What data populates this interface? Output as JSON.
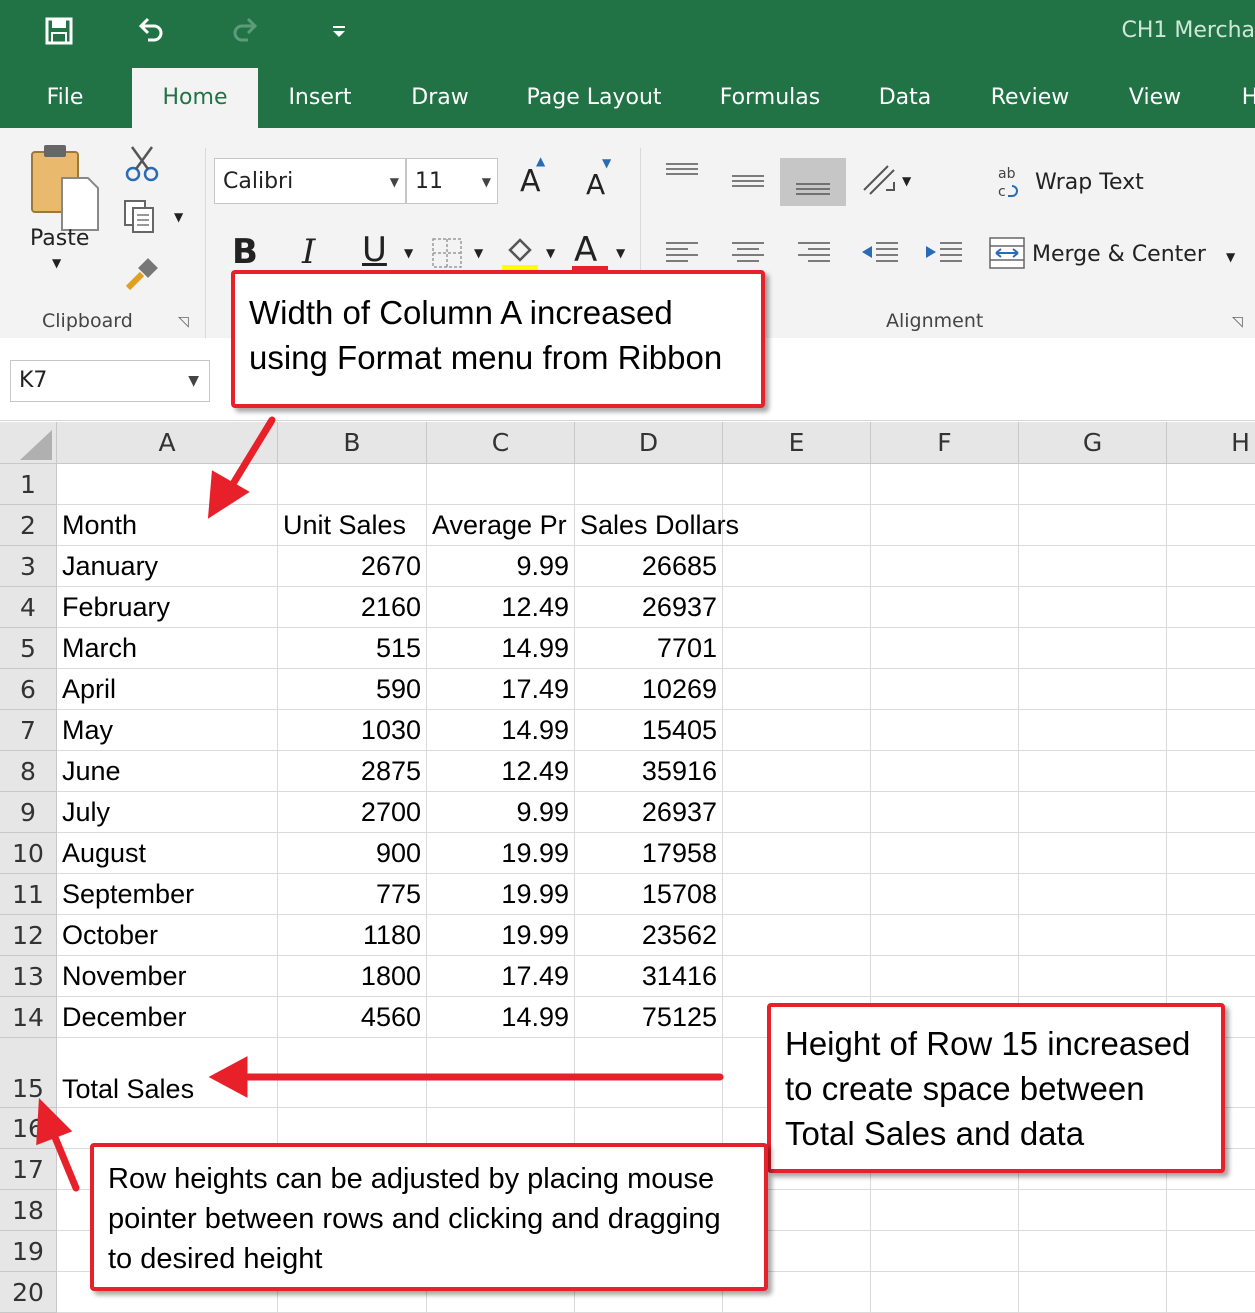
{
  "window": {
    "title": "CH1 Mercha"
  },
  "tabs": [
    "File",
    "Home",
    "Insert",
    "Draw",
    "Page Layout",
    "Formulas",
    "Data",
    "Review",
    "View",
    "H"
  ],
  "active_tab": "Home",
  "ribbon": {
    "clipboard": {
      "paste_label": "Paste",
      "group_label": "Clipboard"
    },
    "font": {
      "name": "Calibri",
      "size": "11",
      "bold": "B",
      "italic": "I",
      "underline": "U",
      "grow": "A",
      "shrink": "A",
      "font_color": "A"
    },
    "alignment": {
      "wrap_text": "Wrap Text",
      "merge_center": "Merge & Center",
      "group_label": "Alignment"
    }
  },
  "name_box": "K7",
  "columns": [
    "A",
    "B",
    "C",
    "D",
    "E",
    "F",
    "G",
    "H"
  ],
  "rows": [
    {
      "n": "1",
      "cells": [
        "",
        "",
        "",
        ""
      ]
    },
    {
      "n": "2",
      "cells": [
        "Month",
        "Unit Sales",
        "Average Pr",
        "Sales Dollars"
      ]
    },
    {
      "n": "3",
      "cells": [
        "January",
        "2670",
        "9.99",
        "26685"
      ]
    },
    {
      "n": "4",
      "cells": [
        "February",
        "2160",
        "12.49",
        "26937"
      ]
    },
    {
      "n": "5",
      "cells": [
        "March",
        "515",
        "14.99",
        "7701"
      ]
    },
    {
      "n": "6",
      "cells": [
        "April",
        "590",
        "17.49",
        "10269"
      ]
    },
    {
      "n": "7",
      "cells": [
        "May",
        "1030",
        "14.99",
        "15405"
      ]
    },
    {
      "n": "8",
      "cells": [
        "June",
        "2875",
        "12.49",
        "35916"
      ]
    },
    {
      "n": "9",
      "cells": [
        "July",
        "2700",
        "9.99",
        "26937"
      ]
    },
    {
      "n": "10",
      "cells": [
        "August",
        "900",
        "19.99",
        "17958"
      ]
    },
    {
      "n": "11",
      "cells": [
        "September",
        "775",
        "19.99",
        "15708"
      ]
    },
    {
      "n": "12",
      "cells": [
        "October",
        "1180",
        "19.99",
        "23562"
      ]
    },
    {
      "n": "13",
      "cells": [
        "November",
        "1800",
        "17.49",
        "31416"
      ]
    },
    {
      "n": "14",
      "cells": [
        "December",
        "4560",
        "14.99",
        "75125"
      ]
    },
    {
      "n": "15",
      "cells": [
        "Total Sales",
        "",
        "",
        ""
      ]
    },
    {
      "n": "16",
      "cells": [
        "",
        "",
        "",
        ""
      ]
    },
    {
      "n": "17",
      "cells": [
        "",
        "",
        "",
        ""
      ]
    },
    {
      "n": "18",
      "cells": [
        "",
        "",
        "",
        ""
      ]
    },
    {
      "n": "19",
      "cells": [
        "",
        "",
        "",
        ""
      ]
    },
    {
      "n": "20",
      "cells": [
        "",
        "",
        "",
        ""
      ]
    }
  ],
  "callouts": {
    "column_width": {
      "line1": "Width of Column A increased",
      "line2": "using Format menu from Ribbon"
    },
    "row_height": {
      "line1": "Height of Row 15 increased",
      "line2": "to create space between",
      "line3": "Total Sales and data"
    },
    "row_adjust": {
      "line1": "Row heights can be adjusted by placing mouse",
      "line2": "pointer between rows and clicking and dragging",
      "line3": "to desired height"
    }
  },
  "colors": {
    "excel_green": "#217346",
    "callout_red": "#e8202a"
  }
}
